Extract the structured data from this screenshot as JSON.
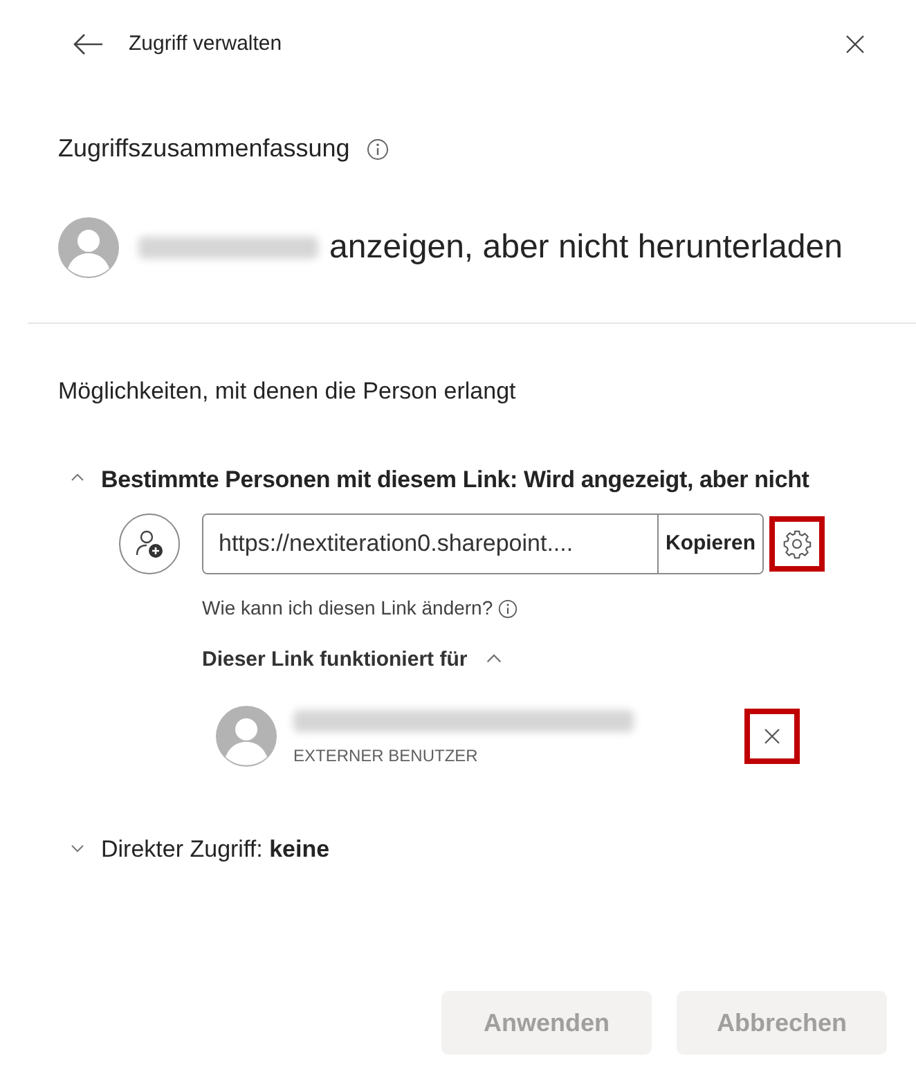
{
  "header": {
    "title": "Zugriff verwalten"
  },
  "summary": {
    "heading": "Zugriffszusammenfassung",
    "access_text": "anzeigen, aber nicht herunterladen"
  },
  "ways_heading": "Möglichkeiten, mit denen die Person erlangt",
  "sections": [
    {
      "kind": "link",
      "title": "Bestimmte Personen mit diesem Link: Wird angezeigt, aber nicht",
      "expanded": true,
      "url": "https://nextiteration0.sharepoint....",
      "copy_label": "Kopieren",
      "settings_highlighted": true,
      "help_text": "Wie kann ich diesen Link ändern?",
      "works_for": {
        "label": "Dieser Link funktioniert für",
        "expanded": true
      },
      "people": [
        {
          "role": "EXTERNER BENUTZER",
          "remove_highlighted": true
        }
      ]
    },
    {
      "kind": "direct",
      "title": "Direkter Zugriff: **keine**",
      "expanded": false
    }
  ],
  "buttons": [
    {
      "label": "Anwenden",
      "disabled": true
    },
    {
      "label": "Abbrechen",
      "disabled": true
    }
  ]
}
